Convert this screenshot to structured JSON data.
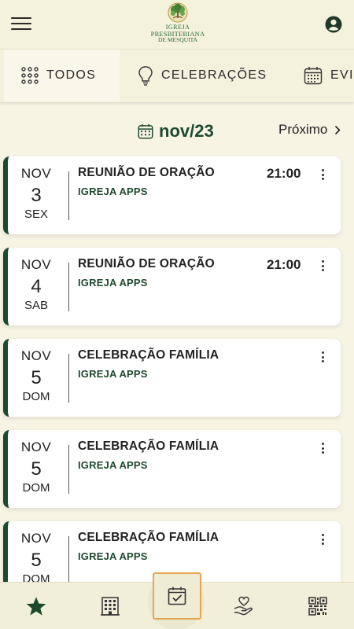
{
  "header": {
    "logo_line1": "IGREJA",
    "logo_line2": "PRESBITERIANA",
    "logo_line3": "DE MESQUITA"
  },
  "tabs": [
    {
      "label": "TODOS",
      "icon": "grid-dots-icon",
      "active": true
    },
    {
      "label": "CELEBRAÇÕES",
      "icon": "lightbulb-icon",
      "active": false
    },
    {
      "label": "EVI",
      "icon": "calendar-icon",
      "active": false
    }
  ],
  "month_nav": {
    "month": "nov/23",
    "next_label": "Próximo"
  },
  "events": [
    {
      "mon": "NOV",
      "day": "3",
      "weekday": "SEX",
      "title": "REUNIÃO DE ORAÇÃO",
      "org": "IGREJA APPS",
      "time": "21:00"
    },
    {
      "mon": "NOV",
      "day": "4",
      "weekday": "SAB",
      "title": "REUNIÃO DE ORAÇÃO",
      "org": "IGREJA APPS",
      "time": "21:00"
    },
    {
      "mon": "NOV",
      "day": "5",
      "weekday": "DOM",
      "title": "CELEBRAÇÃO FAMÍLIA",
      "org": "IGREJA APPS",
      "time": ""
    },
    {
      "mon": "NOV",
      "day": "5",
      "weekday": "DOM",
      "title": "CELEBRAÇÃO FAMÍLIA",
      "org": "IGREJA APPS",
      "time": ""
    },
    {
      "mon": "NOV",
      "day": "5",
      "weekday": "DOM",
      "title": "CELEBRAÇÃO FAMÍLIA",
      "org": "IGREJA APPS",
      "time": ""
    }
  ],
  "bottom_nav": [
    {
      "icon": "star-icon",
      "active": false
    },
    {
      "icon": "building-icon",
      "active": false
    },
    {
      "icon": "calendar-check-icon",
      "active": true
    },
    {
      "icon": "hand-heart-icon",
      "active": false
    },
    {
      "icon": "qr-code-icon",
      "active": false
    }
  ],
  "colors": {
    "background": "#f7f4e4",
    "accent_green": "#1e4a2c",
    "active_outline": "#e8a64a"
  }
}
